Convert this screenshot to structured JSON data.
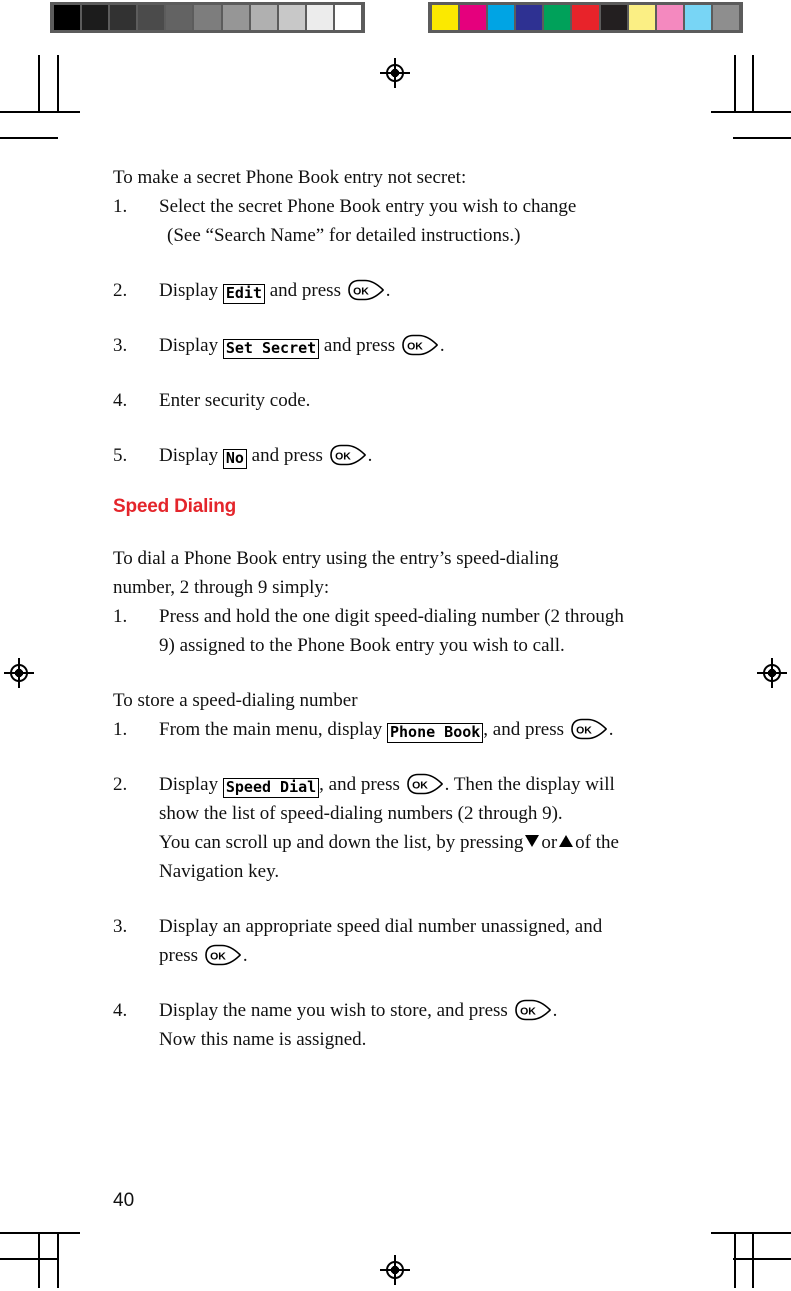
{
  "calibration": {
    "grayscale_bar": {
      "name": "grayscale-step-wedge",
      "patches": [
        "#000000",
        "#1c1c1c",
        "#323232",
        "#4b4b4b",
        "#636363",
        "#7d7d7d",
        "#969696",
        "#b0b0b0",
        "#c8c8c8",
        "#ececec",
        "#ffffff"
      ]
    },
    "color_bar": {
      "name": "process-color-bar",
      "patches": [
        "#fbe900",
        "#e5007d",
        "#00a4e4",
        "#2e3192",
        "#00a15a",
        "#e8232a",
        "#231f20",
        "#fbef84",
        "#f489bf",
        "#78d5f5",
        "#8e8e8e"
      ]
    },
    "strip_background": "#5c5c5c"
  },
  "page": {
    "number": "40",
    "accent_color": "#e4252b"
  },
  "content": {
    "intro": "To make a secret Phone Book entry not secret:",
    "secret_steps": [
      {
        "num": "1.",
        "line1": "Select the secret Phone Book entry you wish to change",
        "line2": "(See “Search Name” for detailed instructions.)"
      },
      {
        "num": "2.",
        "pre": "Display",
        "lcd": "Edit",
        "post": "and press",
        "tail": "."
      },
      {
        "num": "3.",
        "pre": "Display",
        "lcd": "Set Secret",
        "post": "and press",
        "tail": "."
      },
      {
        "num": "4.",
        "line1": "Enter security code."
      },
      {
        "num": "5.",
        "pre": "Display",
        "lcd": "No",
        "post": "and press",
        "tail": "."
      }
    ],
    "heading": "Speed Dialing",
    "dial_intro_line1": "To dial a Phone Book entry using the entry’s speed-dialing",
    "dial_intro_line2": "number, 2 through 9 simply:",
    "dial_step": {
      "num": "1.",
      "line1": "Press and hold the one digit speed-dialing number (2 through",
      "line2": "9) assigned to the Phone Book entry you wish to call."
    },
    "store_intro": "To store a speed-dialing number",
    "store_steps": [
      {
        "num": "1.",
        "pre": "From the main menu, display",
        "lcd": "Phone Book",
        "post": ", and press",
        "tail": "."
      },
      {
        "num": "2.",
        "pre": "Display",
        "lcd": "Speed Dial",
        "post": ", and press",
        "mid": ". Then the display will",
        "line2": "show the list of speed-dialing numbers (2 through 9).",
        "line3_pre": "You can scroll up and down the list, by pressing",
        "line3_mid": "or",
        "line3_post": "of the",
        "line4": "Navigation key."
      },
      {
        "num": "3.",
        "line1": "Display an appropriate speed dial number unassigned, and",
        "line2_pre": "press",
        "line2_tail": "."
      },
      {
        "num": "4.",
        "pre": "Display the name you wish to store, and press",
        "tail": ".",
        "line2": "Now this name is assigned."
      }
    ],
    "ok_key_label": "OK"
  }
}
